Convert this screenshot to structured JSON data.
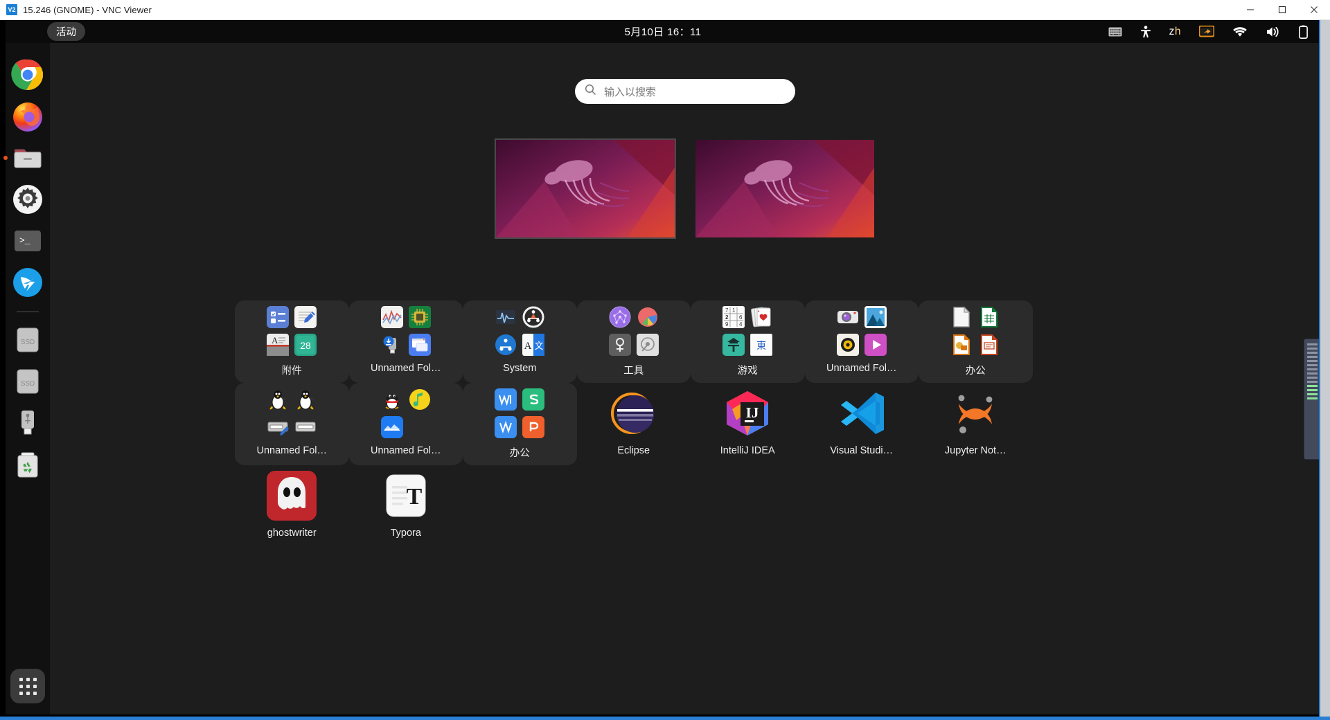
{
  "window": {
    "title": "15.246 (GNOME) - VNC Viewer",
    "icon_label": "V2",
    "buttons": {
      "minimize": "minimize-icon",
      "maximize": "maximize-icon",
      "close": "close-icon"
    }
  },
  "topbar": {
    "activities_label": "活动",
    "clock": "5月10日 16：11",
    "status_icons": [
      {
        "name": "keyboard-icon",
        "label": "keyboard"
      },
      {
        "name": "accessibility-icon",
        "label": "accessibility"
      },
      {
        "name": "input-method-label",
        "label": "zh"
      },
      {
        "name": "screen-share-icon",
        "label": "screen sharing"
      },
      {
        "name": "wifi-icon",
        "label": "wifi"
      },
      {
        "name": "volume-icon",
        "label": "volume"
      },
      {
        "name": "battery-icon",
        "label": "battery"
      }
    ],
    "ime": {
      "first": "z",
      "second": "h"
    },
    "accent": "#e95420"
  },
  "dock": {
    "items": [
      {
        "name": "dock-item-chrome",
        "label": "Google Chrome",
        "running": false
      },
      {
        "name": "dock-item-firefox",
        "label": "Firefox",
        "running": false
      },
      {
        "name": "dock-item-files",
        "label": "Files",
        "running": true
      },
      {
        "name": "dock-item-settings",
        "label": "Settings",
        "running": false
      },
      {
        "name": "dock-item-terminal",
        "label": "Terminal",
        "running": false
      },
      {
        "name": "dock-item-dingtalk",
        "label": "DingTalk",
        "running": false
      },
      {
        "name": "dock-item-ssd-1",
        "label": "SSD",
        "running": false
      },
      {
        "name": "dock-item-ssd-2",
        "label": "SSD",
        "running": false
      },
      {
        "name": "dock-item-usb",
        "label": "USB Drive",
        "running": false
      },
      {
        "name": "dock-item-trash",
        "label": "Trash",
        "running": false
      }
    ],
    "show_apps_label": "Show Applications"
  },
  "overview": {
    "search": {
      "placeholder": "输入以搜索",
      "value": ""
    },
    "workspaces": [
      {
        "name": "workspace-thumbnail-1",
        "active": true
      },
      {
        "name": "workspace-thumbnail-2",
        "active": false
      }
    ],
    "app_grid": {
      "row1": [
        {
          "type": "folder",
          "label": "附件",
          "icons": [
            "todo-icon",
            "text-editor-icon",
            "dictionary-icon",
            "calendar-icon"
          ]
        },
        {
          "type": "folder",
          "label": "Unnamed Fol…",
          "icons": [
            "system-monitor-icon",
            "cpu-icon",
            "usb-creator-icon",
            "remote-desktop-icon"
          ]
        },
        {
          "type": "folder",
          "label": "System",
          "icons": [
            "monitor-graph-icon",
            "software-updater-icon",
            "software-center-icon",
            "translate-icon"
          ]
        },
        {
          "type": "folder",
          "label": "工具",
          "icons": [
            "network-icon",
            "disk-usage-icon",
            "search-tool-icon",
            "disks-icon"
          ]
        },
        {
          "type": "folder",
          "label": "游戏",
          "icons": [
            "sudoku-icon",
            "solitaire-icon",
            "mahjong-icon",
            "mahjong-tile-icon"
          ]
        },
        {
          "type": "folder",
          "label": "Unnamed Fol…",
          "icons": [
            "camera-icon",
            "image-viewer-icon",
            "audio-player-icon",
            "video-player-icon"
          ]
        },
        {
          "type": "folder",
          "label": "办公",
          "icons": [
            "libreoffice-writer-icon",
            "libreoffice-calc-icon",
            "libreoffice-draw-icon",
            "libreoffice-impress-icon"
          ]
        },
        {
          "type": "folder",
          "label": "Unnamed Fol…",
          "icons": [
            "tux-icon",
            "tux-icon",
            "text-entry-edit-icon",
            "text-entry-icon"
          ]
        }
      ],
      "row2": [
        {
          "type": "folder",
          "label": "Unnamed Fol…",
          "icons": [
            "qq-icon",
            "qq-music-icon",
            "meeting-icon",
            ""
          ]
        },
        {
          "type": "folder",
          "label": "办公",
          "icons": [
            "wps-writer-icon",
            "wps-spreadsheet-icon",
            "wps-word-icon",
            "wps-presentation-icon"
          ]
        },
        {
          "type": "app",
          "label": "Eclipse",
          "icon": "eclipse-icon"
        },
        {
          "type": "app",
          "label": "IntelliJ IDEA",
          "icon": "intellij-idea-icon"
        },
        {
          "type": "app",
          "label": "Visual Studi…",
          "icon": "vscode-icon"
        },
        {
          "type": "app",
          "label": "Jupyter Not…",
          "icon": "jupyter-icon"
        },
        {
          "type": "app",
          "label": "ghostwriter",
          "icon": "ghostwriter-icon"
        },
        {
          "type": "app",
          "label": "Typora",
          "icon": "typora-icon"
        }
      ]
    }
  }
}
